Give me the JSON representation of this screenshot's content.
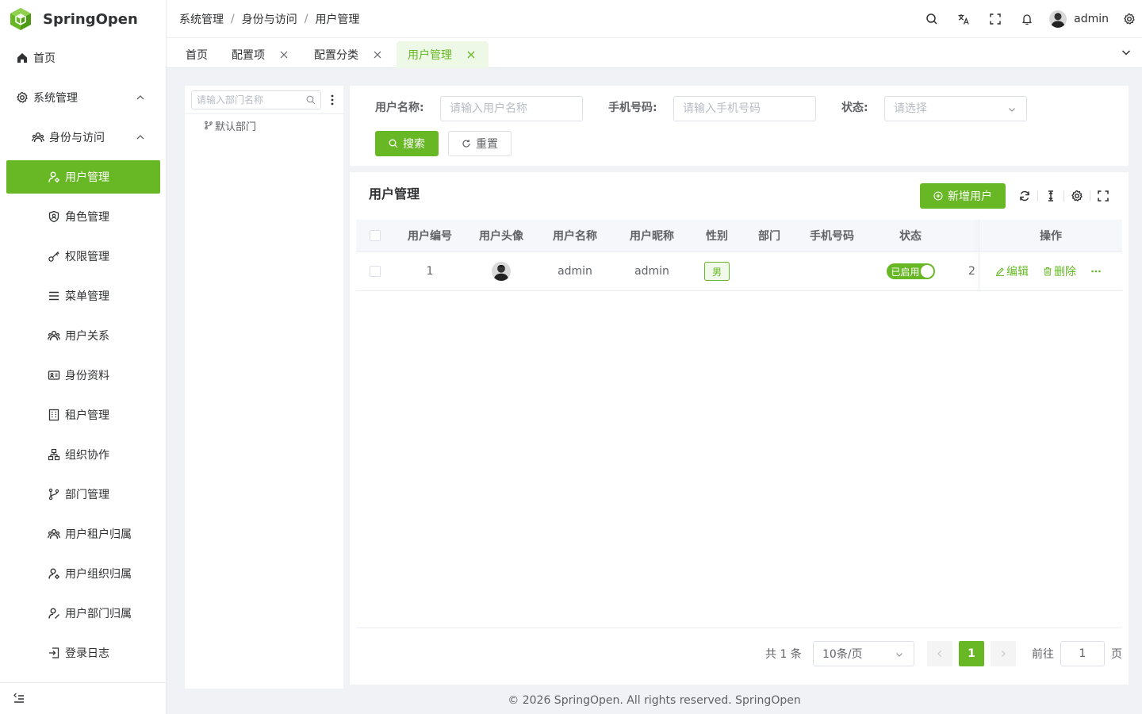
{
  "app": {
    "name": "SpringOpen"
  },
  "colors": {
    "primary": "#67b824",
    "text": "#303133",
    "muted": "#606266",
    "border": "#dcdfe6"
  },
  "sidebar": {
    "items": [
      {
        "label": "首页",
        "icon": "home-icon"
      },
      {
        "label": "系统管理",
        "icon": "gear-icon"
      },
      {
        "label": "身份与访问",
        "icon": "users-icon"
      },
      {
        "label": "用户管理",
        "icon": "user-gear-icon",
        "active": true
      },
      {
        "label": "角色管理",
        "icon": "shield-user-icon"
      },
      {
        "label": "权限管理",
        "icon": "key-icon"
      },
      {
        "label": "菜单管理",
        "icon": "menu-icon"
      },
      {
        "label": "用户关系",
        "icon": "users-icon"
      },
      {
        "label": "身份资料",
        "icon": "id-card-icon"
      },
      {
        "label": "租户管理",
        "icon": "building-icon"
      },
      {
        "label": "组织协作",
        "icon": "org-icon"
      },
      {
        "label": "部门管理",
        "icon": "branch-icon"
      },
      {
        "label": "用户租户归属",
        "icon": "users-icon"
      },
      {
        "label": "用户组织归属",
        "icon": "user-gear-icon"
      },
      {
        "label": "用户部门归属",
        "icon": "user-edit-icon"
      },
      {
        "label": "登录日志",
        "icon": "login-icon"
      }
    ]
  },
  "header": {
    "breadcrumb": [
      "系统管理",
      "身份与访问",
      "用户管理"
    ],
    "breadcrumb_sep": "/",
    "username": "admin"
  },
  "tabs": [
    {
      "label": "首页"
    },
    {
      "label": "配置项"
    },
    {
      "label": "配置分类"
    },
    {
      "label": "用户管理",
      "active": true
    }
  ],
  "dept_tree": {
    "search_placeholder": "请输入部门名称",
    "nodes": [
      "默认部门"
    ]
  },
  "search_form": {
    "username_label": "用户名称:",
    "username_placeholder": "请输入用户名称",
    "phone_label": "手机号码:",
    "phone_placeholder": "请输入手机号码",
    "status_label": "状态:",
    "status_placeholder": "请选择",
    "search_button": "搜索",
    "reset_button": "重置"
  },
  "table": {
    "title": "用户管理",
    "add_button": "新增用户",
    "columns": [
      "用户编号",
      "用户头像",
      "用户名称",
      "用户昵称",
      "性别",
      "部门",
      "手机号码",
      "状态",
      "操作"
    ],
    "rows": [
      {
        "id": "1",
        "username": "admin",
        "nickname": "admin",
        "gender": "男",
        "dept": "",
        "phone": "",
        "status": "已启用",
        "status_on": true,
        "truncated": "2"
      }
    ],
    "actions": {
      "edit": "编辑",
      "delete": "删除"
    }
  },
  "pagination": {
    "total_text": "共 1 条",
    "page_size": "10条/页",
    "current_page": "1",
    "goto_label": "前往",
    "goto_value": "1",
    "page_suffix": "页"
  },
  "footer": {
    "text": "© 2026 SpringOpen. All rights reserved. SpringOpen"
  }
}
